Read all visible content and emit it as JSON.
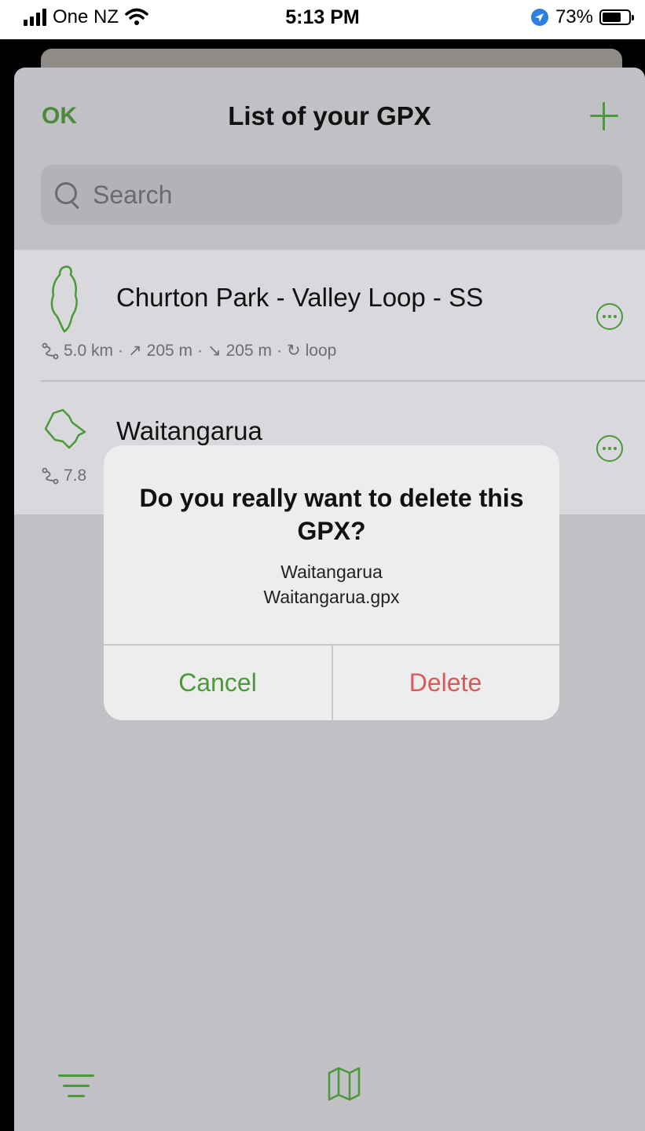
{
  "status_bar": {
    "carrier": "One NZ",
    "time": "5:13 PM",
    "battery": "73%",
    "battery_level": 0.73
  },
  "header": {
    "ok_label": "OK",
    "title": "List of your GPX",
    "add_icon": "plus-icon"
  },
  "search": {
    "placeholder": "Search"
  },
  "tracks": [
    {
      "name": "Churton Park - Valley Loop - SS",
      "distance": "5.0 km",
      "ascent": "205 m",
      "descent": "205 m",
      "type": "loop"
    },
    {
      "name": "Waitangarua",
      "distance": "7.8"
    }
  ],
  "alert": {
    "title": "Do you really want to delete this GPX?",
    "line1": "Waitangarua",
    "line2": "Waitangarua.gpx",
    "cancel_label": "Cancel",
    "delete_label": "Delete"
  },
  "colors": {
    "accent": "#4a9a3a",
    "destructive": "#d85a5a",
    "sheet_bg": "#c1c0c5"
  }
}
